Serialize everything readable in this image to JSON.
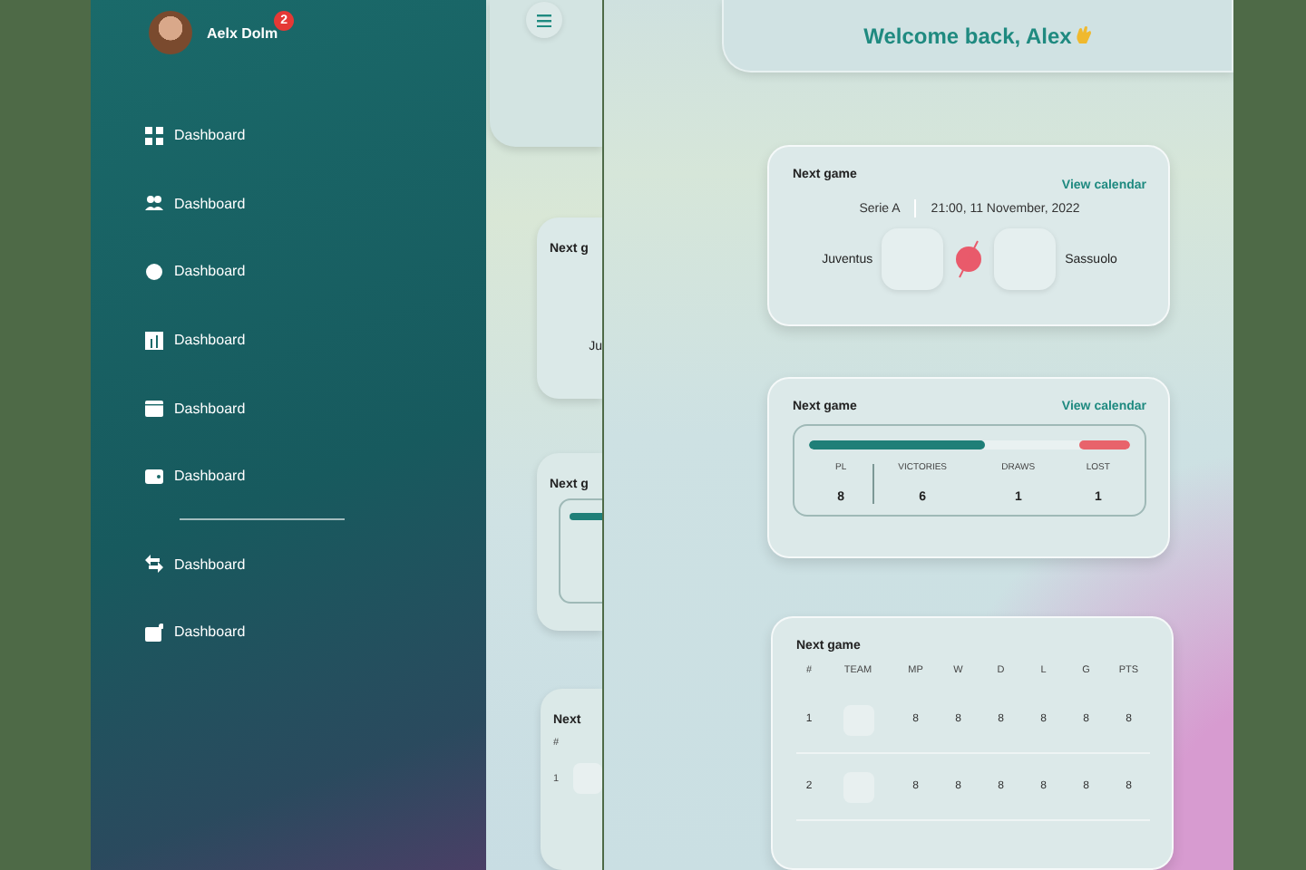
{
  "sidebar": {
    "user": {
      "name": "Aelx Dolm",
      "badge": "2"
    },
    "items": [
      "Dashboard",
      "Dashboard",
      "Dashboard",
      "Dashboard",
      "Dashboard",
      "Dashboard"
    ],
    "bottom_items": [
      "Dashboard",
      "Dashboard"
    ]
  },
  "peek": {
    "card_1": {
      "title": "Next g",
      "team": "Ju"
    },
    "card_2": {
      "title": "Next g"
    },
    "card_3": {
      "title": "Next",
      "column": "#",
      "rank": "1"
    }
  },
  "main": {
    "welcome": "Welcome back, Alex",
    "next_game": {
      "title": "Next game",
      "link": "View calendar",
      "league": "Serie A",
      "datetime": "21:00, 11 November, 2022",
      "home": "Juventus",
      "away": "Sassuolo"
    },
    "record": {
      "title": "Next game",
      "link": "View calendar",
      "bar": [
        {
          "color": "#1f7f78",
          "level": 0.55
        },
        {
          "color": "#e8636b",
          "level": 0.16
        }
      ],
      "stats": [
        {
          "label": "PL",
          "value": "8"
        },
        {
          "label": "VICTORIES",
          "value": "6"
        },
        {
          "label": "DRAWS",
          "value": "1"
        },
        {
          "label": "LOST",
          "value": "1"
        }
      ]
    },
    "table": {
      "title": "Next game",
      "columns": [
        "#",
        "TEAM",
        "MP",
        "W",
        "D",
        "L",
        "G",
        "PTS"
      ],
      "rows": [
        {
          "rank": "1",
          "values": [
            "8",
            "8",
            "8",
            "8",
            "8",
            "8"
          ]
        },
        {
          "rank": "2",
          "values": [
            "8",
            "8",
            "8",
            "8",
            "8",
            "8"
          ]
        }
      ]
    }
  }
}
